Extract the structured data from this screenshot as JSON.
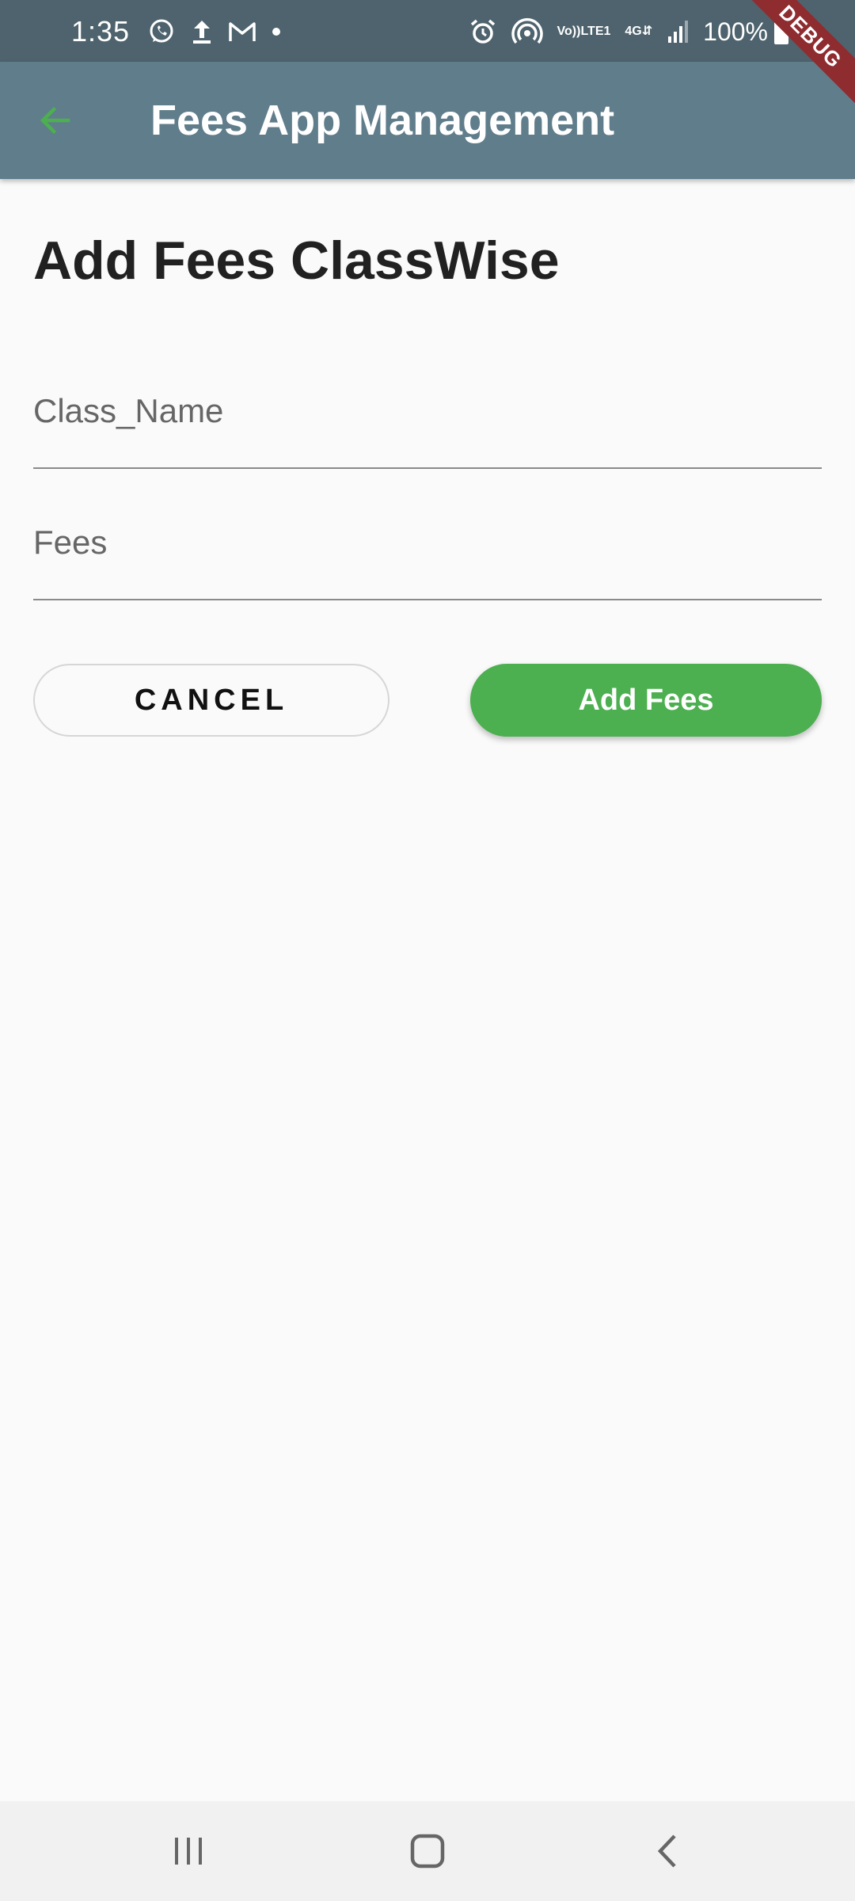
{
  "status_bar": {
    "time": "1:35",
    "battery": "100%",
    "volte_line1": "Vo))",
    "volte_line2": "LTE1",
    "network": "4G",
    "icons": [
      "whatsapp-icon",
      "upload-icon",
      "gmail-icon",
      "dot-icon",
      "alarm-icon",
      "hotspot-icon",
      "volte-icon",
      "4g-icon",
      "signal-icon",
      "battery-icon"
    ]
  },
  "debug_banner": "DEBUG",
  "app_bar": {
    "title": "Fees App Management",
    "back_icon": "arrow-back-icon",
    "accent_color": "#4caf50",
    "background_color": "#607d8b"
  },
  "page": {
    "heading": "Add Fees ClassWise"
  },
  "form": {
    "class_name": {
      "placeholder": "Class_Name",
      "value": ""
    },
    "fees": {
      "placeholder": "Fees",
      "value": ""
    }
  },
  "buttons": {
    "cancel_label": "CANCEL",
    "add_label": "Add Fees",
    "add_color": "#4caf50"
  },
  "nav_bar": {
    "icons": [
      "recents-icon",
      "home-icon",
      "back-icon"
    ]
  }
}
